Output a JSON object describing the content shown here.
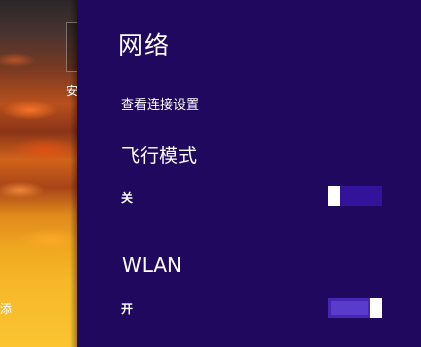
{
  "desktop": {
    "icon_glyphs": [
      "安",
      "添"
    ]
  },
  "network_pane": {
    "title": "网络",
    "view_connection_settings": "查看连接设置",
    "airplane_mode": {
      "title": "飞行模式",
      "state_label": "关",
      "is_on": false
    },
    "wlan": {
      "title": "WLAN",
      "state_label": "开",
      "is_on": true
    }
  },
  "colors": {
    "pane_background": "#20085e",
    "toggle_track": "#32149a",
    "toggle_thumb": "#ffffff"
  }
}
